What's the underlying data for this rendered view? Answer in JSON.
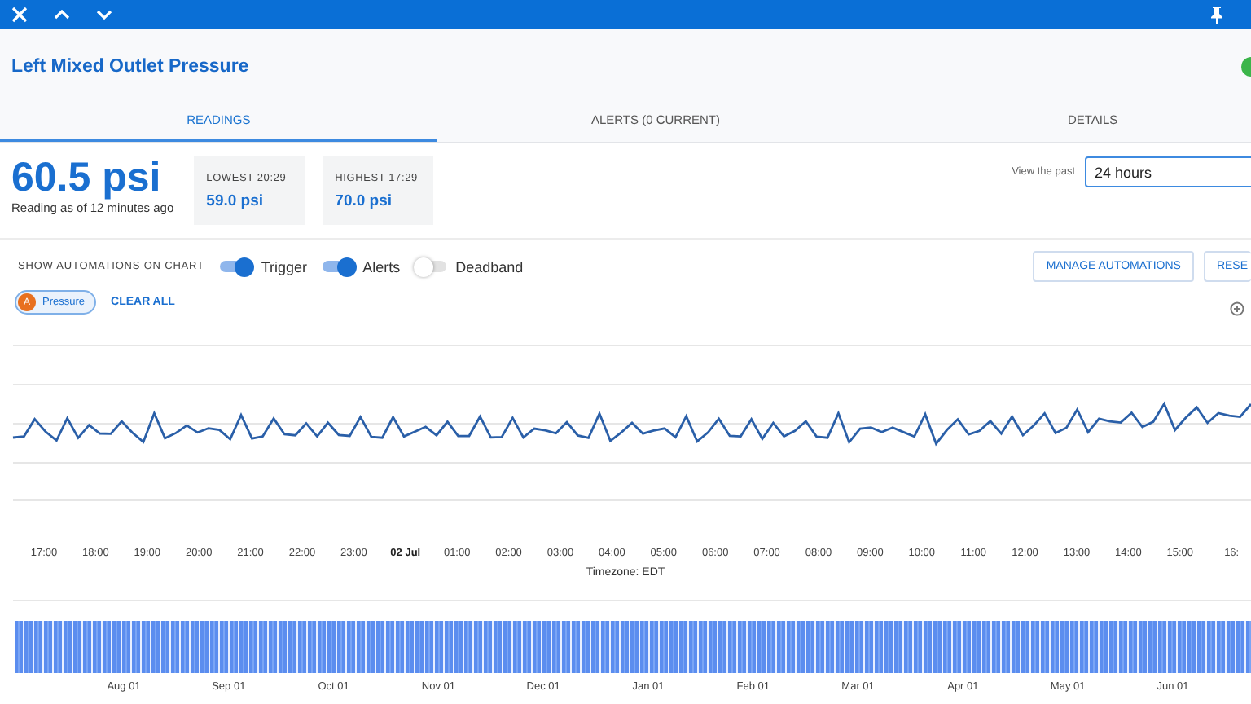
{
  "title": "Left Mixed Outlet Pressure",
  "tabs": [
    {
      "label": "READINGS",
      "selected": true
    },
    {
      "label": "ALERTS (0 CURRENT)",
      "selected": false
    },
    {
      "label": "DETAILS",
      "selected": false
    }
  ],
  "reading": {
    "value": "60.5 psi",
    "caption": "Reading as of 12 minutes ago"
  },
  "stats": [
    {
      "label": "LOWEST 20:29",
      "value": "59.0 psi"
    },
    {
      "label": "HIGHEST 17:29",
      "value": "70.0 psi"
    }
  ],
  "range": {
    "label": "View the past",
    "value": "24 hours"
  },
  "automations": {
    "label": "SHOW AUTOMATIONS ON CHART",
    "toggles": [
      {
        "label": "Trigger",
        "on": true
      },
      {
        "label": "Alerts",
        "on": true
      },
      {
        "label": "Deadband",
        "on": false
      }
    ]
  },
  "buttons": [
    "MANAGE AUTOMATIONS",
    "RESE"
  ],
  "series_chips": [
    {
      "badge": "A",
      "label": "Pressure"
    }
  ],
  "clear_all": "CLEAR ALL",
  "chart": {
    "x_ticks": [
      {
        "label": "17:00",
        "kind": "time"
      },
      {
        "label": "18:00",
        "kind": "time"
      },
      {
        "label": "19:00",
        "kind": "time"
      },
      {
        "label": "20:00",
        "kind": "time"
      },
      {
        "label": "21:00",
        "kind": "time"
      },
      {
        "label": "22:00",
        "kind": "time"
      },
      {
        "label": "23:00",
        "kind": "time"
      },
      {
        "label": "02 Jul",
        "kind": "date"
      },
      {
        "label": "01:00",
        "kind": "time"
      },
      {
        "label": "02:00",
        "kind": "time"
      },
      {
        "label": "03:00",
        "kind": "time"
      },
      {
        "label": "04:00",
        "kind": "time"
      },
      {
        "label": "05:00",
        "kind": "time"
      },
      {
        "label": "06:00",
        "kind": "time"
      },
      {
        "label": "07:00",
        "kind": "time"
      },
      {
        "label": "08:00",
        "kind": "time"
      },
      {
        "label": "09:00",
        "kind": "time"
      },
      {
        "label": "10:00",
        "kind": "time"
      },
      {
        "label": "11:00",
        "kind": "time"
      },
      {
        "label": "12:00",
        "kind": "time"
      },
      {
        "label": "13:00",
        "kind": "time"
      },
      {
        "label": "14:00",
        "kind": "time"
      },
      {
        "label": "15:00",
        "kind": "time"
      },
      {
        "label": "16:",
        "kind": "time"
      }
    ],
    "timezone": "Timezone: EDT"
  },
  "navigator": {
    "ticks": [
      "Aug 01",
      "Sep 01",
      "Oct 01",
      "Nov 01",
      "Dec 01",
      "Jan 01",
      "Feb 01",
      "Mar 01",
      "Apr 01",
      "May 01",
      "Jun 01"
    ]
  }
}
